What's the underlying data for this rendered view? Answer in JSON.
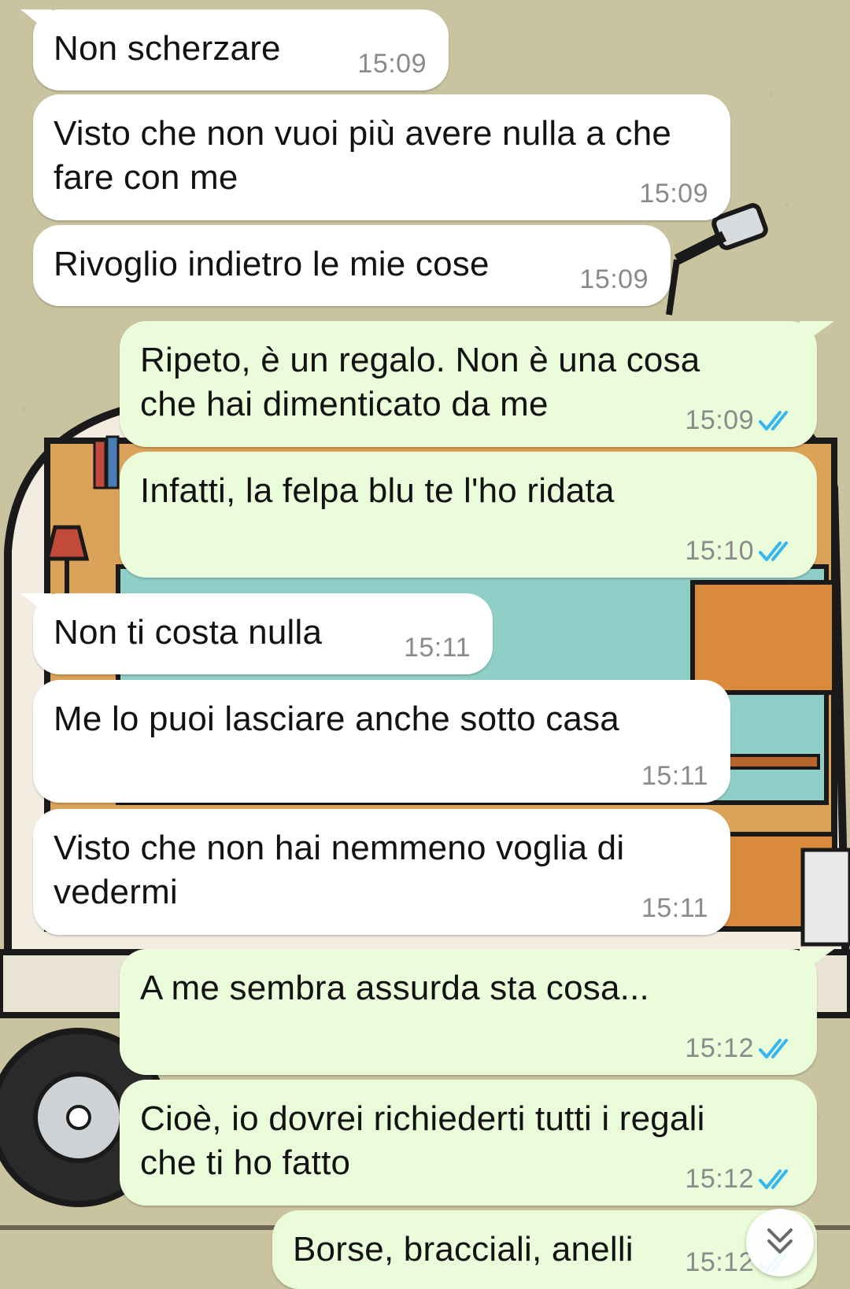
{
  "chat": {
    "messages": [
      {
        "direction": "in",
        "text": "Non scherzare",
        "time": "15:09"
      },
      {
        "direction": "in",
        "text": "Visto che non vuoi più avere nulla a che fare con me",
        "time": "15:09"
      },
      {
        "direction": "in",
        "text": "Rivoglio indietro le mie cose",
        "time": "15:09"
      },
      {
        "direction": "out",
        "text": "Ripeto, è un regalo. Non è una cosa che hai dimenticato da me",
        "time": "15:09",
        "status": "read"
      },
      {
        "direction": "out",
        "text": "Infatti, la felpa blu te l'ho ridata",
        "time": "15:10",
        "status": "read"
      },
      {
        "direction": "in",
        "text": "Non ti costa nulla",
        "time": "15:11"
      },
      {
        "direction": "in",
        "text": "Me lo puoi lasciare anche sotto casa",
        "time": "15:11"
      },
      {
        "direction": "in",
        "text": "Visto che non hai nemmeno voglia di vedermi",
        "time": "15:11"
      },
      {
        "direction": "out",
        "text": "A me sembra assurda sta cosa...",
        "time": "15:12",
        "status": "read"
      },
      {
        "direction": "out",
        "text": "Cioè, io dovrei richiederti tutti i regali che ti ho fatto",
        "time": "15:12",
        "status": "read"
      },
      {
        "direction": "out",
        "text": "Borse, bracciali, anelli",
        "time": "15:12",
        "status": "read"
      }
    ]
  },
  "icons": {
    "read_status": "double-check-icon",
    "scroll_down": "chevron-double-down-icon"
  },
  "colors": {
    "incoming_bubble": "#ffffff",
    "outgoing_bubble": "#eafcd9",
    "read_tick": "#34b7f1",
    "timestamp": "#8a8a8a"
  }
}
